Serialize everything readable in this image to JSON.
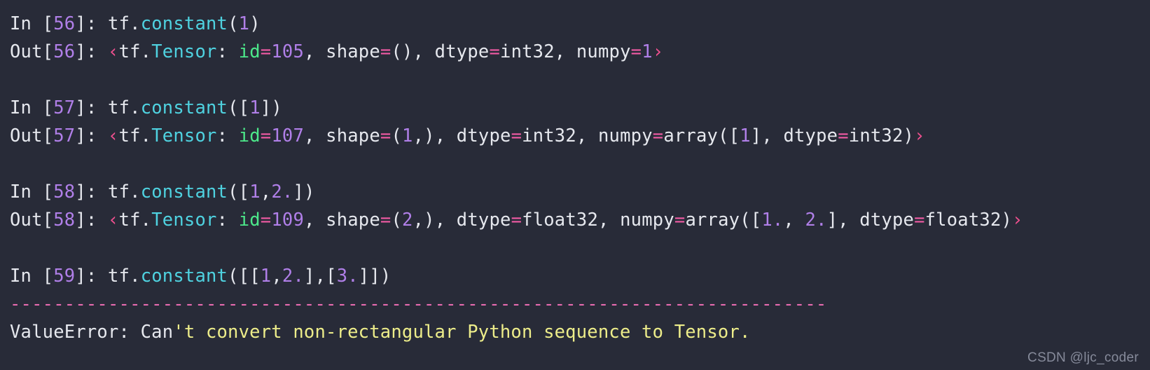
{
  "terminal": {
    "background_color": "#282b38",
    "colors": {
      "text": "#e6e8ee",
      "number": "#b07fe8",
      "function": "#4fd2e0",
      "keyword_green": "#4ce88a",
      "equals": "#f25ba5",
      "angle_bracket": "#f0508f",
      "string": "#eded8a",
      "divider": "#e86bb0"
    },
    "cells": [
      {
        "type": "input",
        "prompt": "In [56]:",
        "prompt_label": "In",
        "count": "56",
        "code": "tf.constant(1)",
        "tokens": [
          {
            "text": "In ",
            "cls": "t-plain"
          },
          {
            "text": "[",
            "cls": "t-plain"
          },
          {
            "text": "56",
            "cls": "t-num"
          },
          {
            "text": "]: ",
            "cls": "t-plain"
          },
          {
            "text": "tf.",
            "cls": "t-plain"
          },
          {
            "text": "constant",
            "cls": "t-func"
          },
          {
            "text": "(",
            "cls": "t-plain"
          },
          {
            "text": "1",
            "cls": "t-num"
          },
          {
            "text": ")",
            "cls": "t-plain"
          }
        ]
      },
      {
        "type": "output",
        "prompt": "Out[56]:",
        "prompt_label": "Out",
        "count": "56",
        "code": "<tf.Tensor: id=105, shape=(), dtype=int32, numpy=1>",
        "tokens": [
          {
            "text": "Out",
            "cls": "t-plain"
          },
          {
            "text": "[",
            "cls": "t-plain"
          },
          {
            "text": "56",
            "cls": "t-num"
          },
          {
            "text": "]: ",
            "cls": "t-plain"
          },
          {
            "text": "‹",
            "cls": "t-angle"
          },
          {
            "text": "tf.",
            "cls": "t-plain"
          },
          {
            "text": "Tensor",
            "cls": "t-func"
          },
          {
            "text": ": ",
            "cls": "t-plain"
          },
          {
            "text": "id",
            "cls": "t-green"
          },
          {
            "text": "=",
            "cls": "t-eq"
          },
          {
            "text": "105",
            "cls": "t-num"
          },
          {
            "text": ", shape",
            "cls": "t-plain"
          },
          {
            "text": "=",
            "cls": "t-eq"
          },
          {
            "text": "(), dtype",
            "cls": "t-plain"
          },
          {
            "text": "=",
            "cls": "t-eq"
          },
          {
            "text": "int32, numpy",
            "cls": "t-plain"
          },
          {
            "text": "=",
            "cls": "t-eq"
          },
          {
            "text": "1",
            "cls": "t-num"
          },
          {
            "text": "›",
            "cls": "t-angle"
          }
        ]
      },
      {
        "type": "blank"
      },
      {
        "type": "input",
        "prompt": "In [57]:",
        "prompt_label": "In",
        "count": "57",
        "code": "tf.constant([1])",
        "tokens": [
          {
            "text": "In ",
            "cls": "t-plain"
          },
          {
            "text": "[",
            "cls": "t-plain"
          },
          {
            "text": "57",
            "cls": "t-num"
          },
          {
            "text": "]: ",
            "cls": "t-plain"
          },
          {
            "text": "tf.",
            "cls": "t-plain"
          },
          {
            "text": "constant",
            "cls": "t-func"
          },
          {
            "text": "([",
            "cls": "t-plain"
          },
          {
            "text": "1",
            "cls": "t-num"
          },
          {
            "text": "])",
            "cls": "t-plain"
          }
        ]
      },
      {
        "type": "output",
        "prompt": "Out[57]:",
        "prompt_label": "Out",
        "count": "57",
        "code": "<tf.Tensor: id=107, shape=(1,), dtype=int32, numpy=array([1], dtype=int32)>",
        "tokens": [
          {
            "text": "Out",
            "cls": "t-plain"
          },
          {
            "text": "[",
            "cls": "t-plain"
          },
          {
            "text": "57",
            "cls": "t-num"
          },
          {
            "text": "]: ",
            "cls": "t-plain"
          },
          {
            "text": "‹",
            "cls": "t-angle"
          },
          {
            "text": "tf.",
            "cls": "t-plain"
          },
          {
            "text": "Tensor",
            "cls": "t-func"
          },
          {
            "text": ": ",
            "cls": "t-plain"
          },
          {
            "text": "id",
            "cls": "t-green"
          },
          {
            "text": "=",
            "cls": "t-eq"
          },
          {
            "text": "107",
            "cls": "t-num"
          },
          {
            "text": ", shape",
            "cls": "t-plain"
          },
          {
            "text": "=",
            "cls": "t-eq"
          },
          {
            "text": "(",
            "cls": "t-plain"
          },
          {
            "text": "1",
            "cls": "t-num"
          },
          {
            "text": ",), dtype",
            "cls": "t-plain"
          },
          {
            "text": "=",
            "cls": "t-eq"
          },
          {
            "text": "int32, numpy",
            "cls": "t-plain"
          },
          {
            "text": "=",
            "cls": "t-eq"
          },
          {
            "text": "array([",
            "cls": "t-plain"
          },
          {
            "text": "1",
            "cls": "t-num"
          },
          {
            "text": "], dtype",
            "cls": "t-plain"
          },
          {
            "text": "=",
            "cls": "t-eq"
          },
          {
            "text": "int32)",
            "cls": "t-plain"
          },
          {
            "text": "›",
            "cls": "t-angle"
          }
        ]
      },
      {
        "type": "blank"
      },
      {
        "type": "input",
        "prompt": "In [58]:",
        "prompt_label": "In",
        "count": "58",
        "code": "tf.constant([1,2.])",
        "tokens": [
          {
            "text": "In ",
            "cls": "t-plain"
          },
          {
            "text": "[",
            "cls": "t-plain"
          },
          {
            "text": "58",
            "cls": "t-num"
          },
          {
            "text": "]: ",
            "cls": "t-plain"
          },
          {
            "text": "tf.",
            "cls": "t-plain"
          },
          {
            "text": "constant",
            "cls": "t-func"
          },
          {
            "text": "([",
            "cls": "t-plain"
          },
          {
            "text": "1",
            "cls": "t-num"
          },
          {
            "text": ",",
            "cls": "t-plain"
          },
          {
            "text": "2.",
            "cls": "t-num"
          },
          {
            "text": "])",
            "cls": "t-plain"
          }
        ]
      },
      {
        "type": "output",
        "prompt": "Out[58]:",
        "prompt_label": "Out",
        "count": "58",
        "code": "<tf.Tensor: id=109, shape=(2,), dtype=float32, numpy=array([1., 2.], dtype=float32)>",
        "tokens": [
          {
            "text": "Out",
            "cls": "t-plain"
          },
          {
            "text": "[",
            "cls": "t-plain"
          },
          {
            "text": "58",
            "cls": "t-num"
          },
          {
            "text": "]: ",
            "cls": "t-plain"
          },
          {
            "text": "‹",
            "cls": "t-angle"
          },
          {
            "text": "tf.",
            "cls": "t-plain"
          },
          {
            "text": "Tensor",
            "cls": "t-func"
          },
          {
            "text": ": ",
            "cls": "t-plain"
          },
          {
            "text": "id",
            "cls": "t-green"
          },
          {
            "text": "=",
            "cls": "t-eq"
          },
          {
            "text": "109",
            "cls": "t-num"
          },
          {
            "text": ", shape",
            "cls": "t-plain"
          },
          {
            "text": "=",
            "cls": "t-eq"
          },
          {
            "text": "(",
            "cls": "t-plain"
          },
          {
            "text": "2",
            "cls": "t-num"
          },
          {
            "text": ",), dtype",
            "cls": "t-plain"
          },
          {
            "text": "=",
            "cls": "t-eq"
          },
          {
            "text": "float32, numpy",
            "cls": "t-plain"
          },
          {
            "text": "=",
            "cls": "t-eq"
          },
          {
            "text": "array([",
            "cls": "t-plain"
          },
          {
            "text": "1.",
            "cls": "t-num"
          },
          {
            "text": ", ",
            "cls": "t-plain"
          },
          {
            "text": "2.",
            "cls": "t-num"
          },
          {
            "text": "], dtype",
            "cls": "t-plain"
          },
          {
            "text": "=",
            "cls": "t-eq"
          },
          {
            "text": "float32)",
            "cls": "t-plain"
          },
          {
            "text": "›",
            "cls": "t-angle"
          }
        ]
      },
      {
        "type": "blank"
      },
      {
        "type": "input",
        "prompt": "In [59]:",
        "prompt_label": "In",
        "count": "59",
        "code": "tf.constant([[1,2.],[3.]])",
        "tokens": [
          {
            "text": "In ",
            "cls": "t-plain"
          },
          {
            "text": "[",
            "cls": "t-plain"
          },
          {
            "text": "59",
            "cls": "t-num"
          },
          {
            "text": "]: ",
            "cls": "t-plain"
          },
          {
            "text": "tf.",
            "cls": "t-plain"
          },
          {
            "text": "constant",
            "cls": "t-func"
          },
          {
            "text": "([[",
            "cls": "t-plain"
          },
          {
            "text": "1",
            "cls": "t-num"
          },
          {
            "text": ",",
            "cls": "t-plain"
          },
          {
            "text": "2.",
            "cls": "t-num"
          },
          {
            "text": "],[",
            "cls": "t-plain"
          },
          {
            "text": "3.",
            "cls": "t-num"
          },
          {
            "text": "]])",
            "cls": "t-plain"
          }
        ]
      },
      {
        "type": "divider",
        "code": "---------------------------------------------------------------------------"
      },
      {
        "type": "error",
        "code": "ValueError: Can't convert non-rectangular Python sequence to Tensor.",
        "error_type": "ValueError",
        "error_message": "Can't convert non-rectangular Python sequence to Tensor.",
        "tokens": [
          {
            "text": "ValueError: Can",
            "cls": "t-plain"
          },
          {
            "text": "'t convert non-rectangular Python sequence to Tensor.",
            "cls": "t-str"
          }
        ]
      }
    ]
  },
  "watermark": {
    "text": "CSDN @ljc_coder"
  }
}
